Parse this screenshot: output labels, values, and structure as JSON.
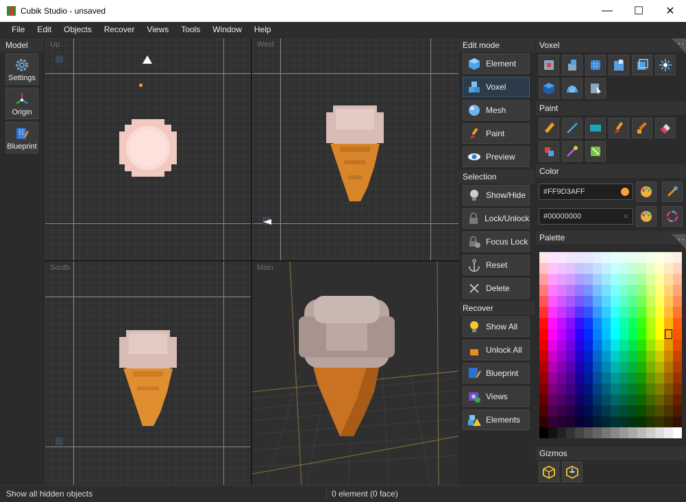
{
  "window": {
    "title": "Cubik Studio - unsaved",
    "minimize": "—",
    "maximize": "☐",
    "close": "✕"
  },
  "menu": [
    "File",
    "Edit",
    "Objects",
    "Recover",
    "Views",
    "Tools",
    "Window",
    "Help"
  ],
  "model_panel": {
    "header": "Model",
    "buttons": [
      {
        "label": "Settings",
        "icon": "gear-icon"
      },
      {
        "label": "Origin",
        "icon": "axes-icon"
      },
      {
        "label": "Blueprint",
        "icon": "blueprint-icon"
      }
    ]
  },
  "viewports": {
    "up": "Up",
    "west": "West",
    "south": "South",
    "main": "Main"
  },
  "edit_mode": {
    "header": "Edit mode",
    "buttons": [
      {
        "label": "Element",
        "icon": "cube-icon"
      },
      {
        "label": "Voxel",
        "icon": "voxel-icon",
        "active": true
      },
      {
        "label": "Mesh",
        "icon": "sphere-icon"
      },
      {
        "label": "Paint",
        "icon": "brush-icon"
      },
      {
        "label": "Preview",
        "icon": "eye-icon"
      }
    ]
  },
  "selection": {
    "header": "Selection",
    "buttons": [
      {
        "label": "Show/Hide",
        "icon": "lightbulb-icon"
      },
      {
        "label": "Lock/Unlock",
        "icon": "lock-icon"
      },
      {
        "label": "Focus Lock",
        "icon": "focus-lock-icon"
      },
      {
        "label": "Reset",
        "icon": "anchor-icon"
      },
      {
        "label": "Delete",
        "icon": "delete-icon"
      }
    ]
  },
  "recover": {
    "header": "Recover",
    "buttons": [
      {
        "label": "Show All",
        "icon": "lightbulb-icon"
      },
      {
        "label": "Unlock All",
        "icon": "unlock-icon"
      },
      {
        "label": "Blueprint",
        "icon": "blueprint-icon"
      },
      {
        "label": "Views",
        "icon": "views-icon"
      },
      {
        "label": "Elements",
        "icon": "elements-warning-icon"
      }
    ]
  },
  "voxel": {
    "header": "Voxel"
  },
  "paint": {
    "header": "Paint"
  },
  "color": {
    "header": "Color",
    "primary": "#FF9D3AFF",
    "secondary": "#00000000",
    "primary_swatch": "#ff9d3a"
  },
  "palette": {
    "header": "Palette"
  },
  "gizmos": {
    "header": "Gizmos"
  },
  "status": {
    "left": "Show all hidden objects",
    "middle": "0 element (0 face)"
  },
  "colors": {
    "accent": "#3d8fd8",
    "cream": "#f5d9d2",
    "cone": "#d9862a",
    "scoop_main": "#b7a49e",
    "dark_bg": "#2b2b2b"
  }
}
